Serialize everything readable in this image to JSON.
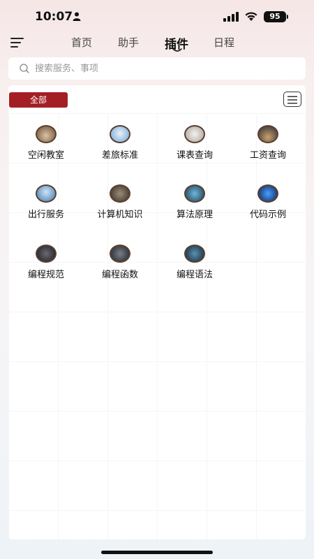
{
  "status": {
    "time": "10:07",
    "battery": "95"
  },
  "nav": {
    "tabs": [
      {
        "label": "首页"
      },
      {
        "label": "助手"
      },
      {
        "label": "插件"
      },
      {
        "label": "日程"
      }
    ],
    "active": "插件"
  },
  "search": {
    "placeholder": "搜索服务、事项"
  },
  "filter": {
    "all_label": "全部"
  },
  "plugins": [
    {
      "label": "空闲教室",
      "icon": "classroom-icon"
    },
    {
      "label": "差旅标准",
      "icon": "airplane-icon"
    },
    {
      "label": "课表查询",
      "icon": "schedule-icon"
    },
    {
      "label": "工资查询",
      "icon": "salary-icon"
    },
    {
      "label": "出行服务",
      "icon": "travel-icon"
    },
    {
      "label": "计算机知识",
      "icon": "computer-icon"
    },
    {
      "label": "算法原理",
      "icon": "algorithm-icon"
    },
    {
      "label": "代码示例",
      "icon": "code-icon"
    },
    {
      "label": "编程规范",
      "icon": "coding-standard-icon"
    },
    {
      "label": "编程函数",
      "icon": "function-icon"
    },
    {
      "label": "编程语法",
      "icon": "syntax-icon"
    }
  ],
  "colors": {
    "accent": "#a41f24"
  }
}
